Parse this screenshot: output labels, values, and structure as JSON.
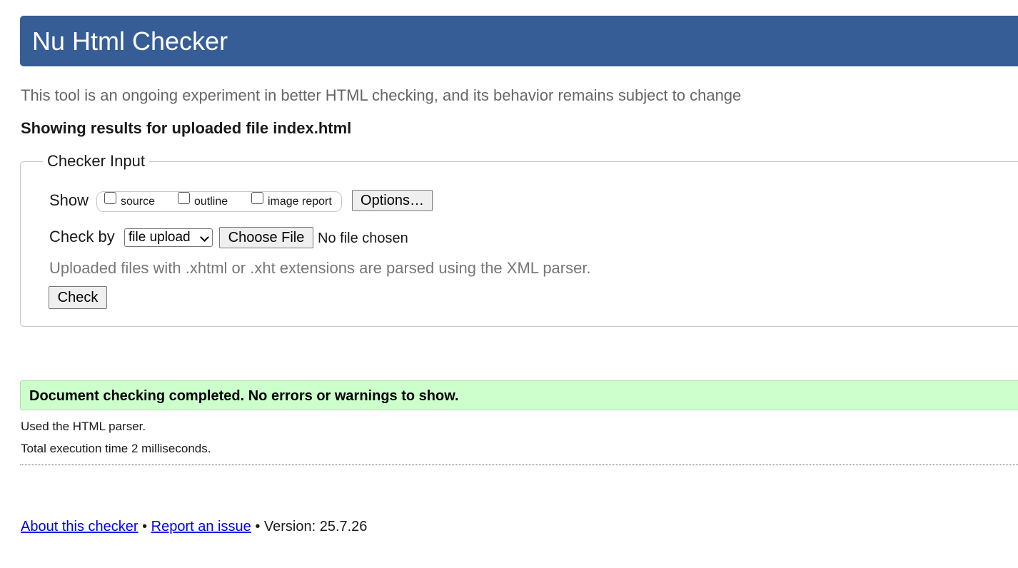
{
  "header": {
    "title": "Nu Html Checker"
  },
  "intro": {
    "subtitle": "This tool is an ongoing experiment in better HTML checking, and its behavior remains subject to change",
    "results_heading": "Showing results for uploaded file index.html"
  },
  "checker_input": {
    "legend": "Checker Input",
    "show_label": "Show",
    "show_options": [
      {
        "label": "source",
        "checked": false
      },
      {
        "label": "outline",
        "checked": false
      },
      {
        "label": "image report",
        "checked": false
      }
    ],
    "options_button": "Options…",
    "check_by_label": "Check by",
    "check_by_selected": "file upload",
    "choose_file_button": "Choose File",
    "file_status": "No file chosen",
    "hint": "Uploaded files with .xhtml or .xht extensions are parsed using the XML parser.",
    "check_button": "Check"
  },
  "result": {
    "message": "Document checking completed. No errors or warnings to show.",
    "parser_info": "Used the HTML parser.",
    "execution_time": "Total execution time 2 milliseconds."
  },
  "footer": {
    "about_link": "About this checker",
    "separator": "•",
    "report_link": "Report an issue",
    "version": "• Version: 25.7.26"
  },
  "colors": {
    "header_bg": "#365d95",
    "success_bg": "#ccffcc",
    "link": "#0000ee"
  }
}
